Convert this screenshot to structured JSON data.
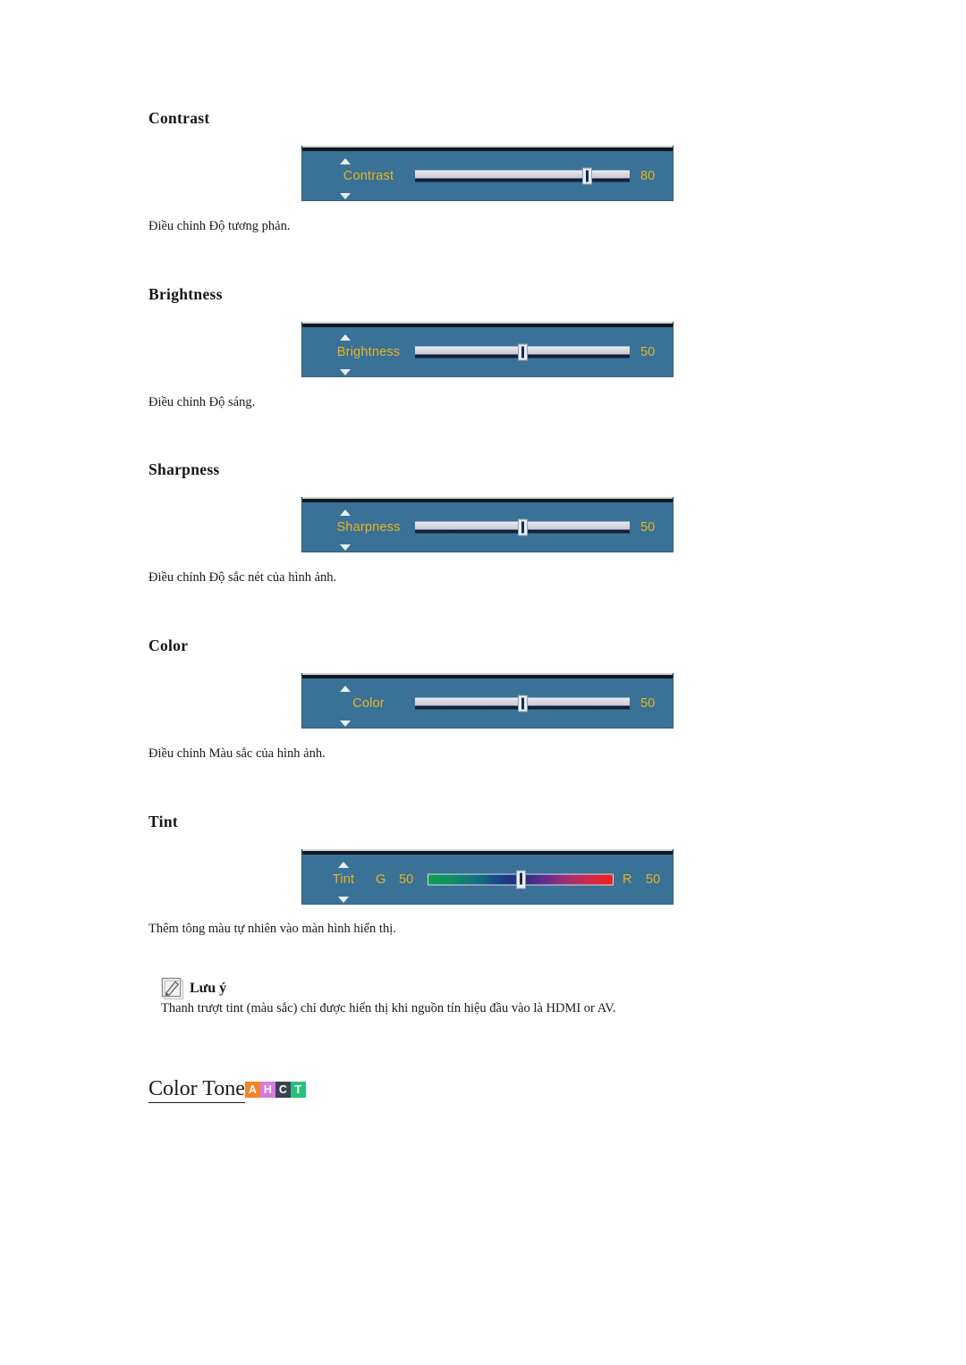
{
  "document": {
    "language": "vi",
    "sections": [
      {
        "id": "contrast",
        "title": "Contrast",
        "caption": "Điều chỉnh Độ tương phản.",
        "osd": {
          "label": "Contrast",
          "value": "80",
          "percent": 80,
          "type": "slider",
          "up_arrow": "arrow-up-icon",
          "down_arrow": "arrow-down-icon"
        }
      },
      {
        "id": "brightness",
        "title": "Brightness",
        "caption": "Điều chỉnh Độ sáng.",
        "osd": {
          "label": "Brightness",
          "value": "50",
          "percent": 50,
          "type": "slider",
          "up_arrow": "arrow-up-icon",
          "down_arrow": "arrow-down-icon"
        }
      },
      {
        "id": "sharpness",
        "title": "Sharpness",
        "caption": "Điều chỉnh Độ sắc nét của hình ảnh.",
        "osd": {
          "label": "Sharpness",
          "value": "50",
          "percent": 50,
          "type": "slider",
          "up_arrow": "arrow-up-icon",
          "down_arrow": "arrow-down-icon"
        }
      },
      {
        "id": "color",
        "title": "Color",
        "caption": "Điều chỉnh Màu sắc của hình ảnh.",
        "osd": {
          "label": "Color",
          "value": "50",
          "percent": 50,
          "type": "slider",
          "up_arrow": "arrow-up-icon",
          "down_arrow": "arrow-down-icon"
        }
      },
      {
        "id": "tint",
        "title": "Tint",
        "caption": "Thêm tông màu tự nhiên vào màn hình hiển thị.",
        "osd": {
          "label": "Tint",
          "type": "gradient-slider",
          "green_letter": "G",
          "green_value": "50",
          "red_letter": "R",
          "red_value": "50",
          "percent": 50,
          "up_arrow": "arrow-up-icon",
          "down_arrow": "arrow-down-icon"
        }
      }
    ],
    "note": {
      "icon": "note-pencil-icon",
      "title": "Lưu ý",
      "body": "Thanh trượt tint (màu sắc) chỉ được hiển thị khi nguồn tín hiệu đầu vào là HDMI or AV."
    },
    "bottom_heading": {
      "text": "Color Tone",
      "badges": [
        {
          "letter": "A",
          "color": "#f5832a"
        },
        {
          "letter": "H",
          "color": "#d47ce0"
        },
        {
          "letter": "C",
          "color": "#3c4152"
        },
        {
          "letter": "T",
          "color": "#2bc07a"
        }
      ]
    },
    "theme": {
      "osd_background": "#3a7197",
      "osd_text": "#e8b51e",
      "osd_top_border": "#111820",
      "slider_fill": "#dcdce6",
      "page_background": "#ffffff"
    }
  }
}
